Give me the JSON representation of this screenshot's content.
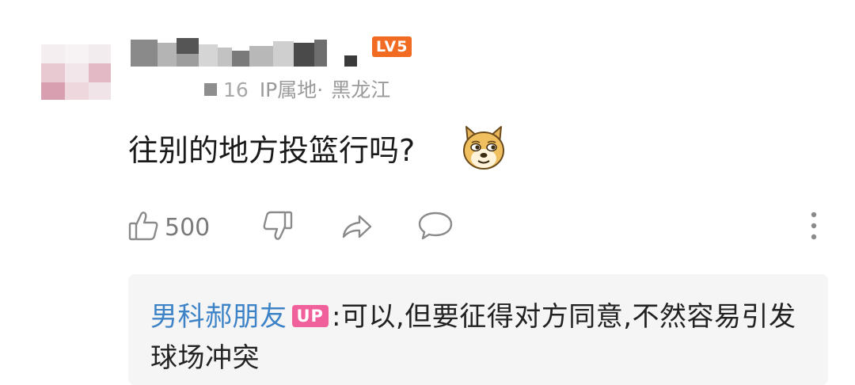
{
  "comment": {
    "level_badge": "LV5",
    "meta_date_fragment": "16",
    "meta_ip_label": "IP属地",
    "meta_separator": "·",
    "meta_location": "黑龙江",
    "text": "往别的地方投篮行吗?",
    "emoji_icon": "doge-emoji-icon"
  },
  "actions": {
    "like_icon": "thumbs-up-icon",
    "like_count": "500",
    "dislike_icon": "thumbs-down-icon",
    "share_icon": "share-icon",
    "reply_icon": "comment-bubble-icon",
    "more_icon": "more-vertical-icon"
  },
  "reply": {
    "author": "男科郝朋友",
    "badge": "UP",
    "colon": ":",
    "text": "可以,但要征得对方同意,不然容易引发球场冲突"
  },
  "colors": {
    "level_badge": "#f26b22",
    "reply_author": "#3d83c8",
    "up_badge": "#f0609a",
    "reply_background": "#f5f5f5"
  }
}
